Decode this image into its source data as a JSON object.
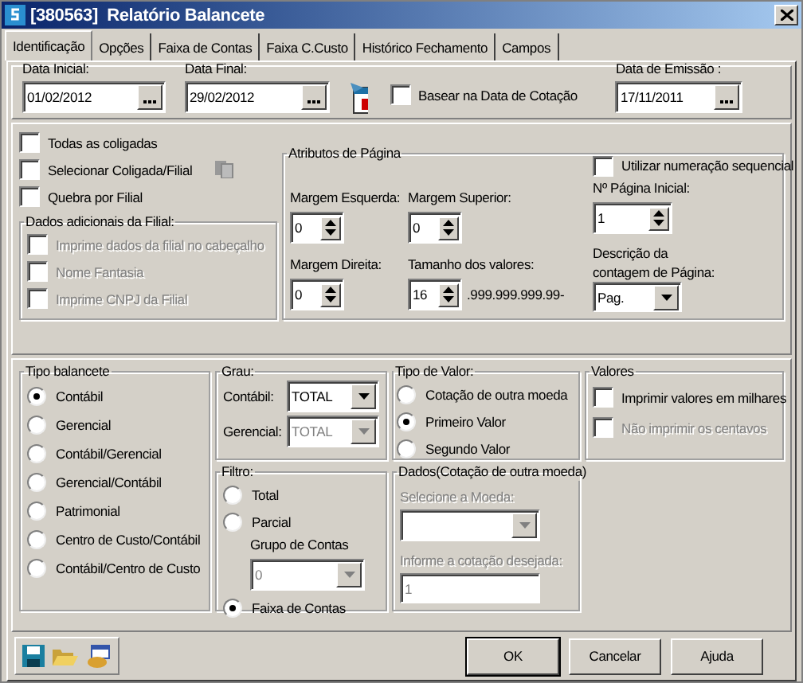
{
  "window": {
    "title": "[380563]  Relatório Balancete"
  },
  "tabs": [
    {
      "label": "Identificação",
      "selected": true
    },
    {
      "label": "Opções",
      "selected": false
    },
    {
      "label": "Faixa de Contas",
      "selected": false
    },
    {
      "label": "Faixa C.Custo",
      "selected": false
    },
    {
      "label": "Histórico Fechamento",
      "selected": false
    },
    {
      "label": "Campos",
      "selected": false
    }
  ],
  "dates": {
    "data_inicial": {
      "label": "Data Inicial:",
      "value": "01/02/2012"
    },
    "data_final": {
      "label": "Data Final:",
      "value": "29/02/2012"
    },
    "basear": {
      "label": "Basear na Data de Cotação",
      "checked": false
    },
    "data_emissao": {
      "label": "Data de Emissão :",
      "value": "17/11/2011"
    }
  },
  "left_options": [
    {
      "label": "Todas as coligadas",
      "checked": false
    },
    {
      "label": "Selecionar Coligada/Filial",
      "checked": false
    },
    {
      "label": "Quebra por Filial",
      "checked": false
    }
  ],
  "dados_filial": {
    "title": "Dados adicionais da Filial:",
    "options": [
      {
        "label": "Imprime dados da filial no cabeçalho",
        "checked": false,
        "disabled": true
      },
      {
        "label": "Nome Fantasia",
        "checked": false,
        "disabled": true
      },
      {
        "label": "Imprime CNPJ da Filial",
        "checked": false,
        "disabled": true
      }
    ]
  },
  "atributos": {
    "title": "Atributos de Página",
    "margem_esquerda": {
      "label": "Margem Esquerda:",
      "value": "0"
    },
    "margem_superior": {
      "label": "Margem Superior:",
      "value": "0"
    },
    "margem_direita": {
      "label": "Margem Direita:",
      "value": "0"
    },
    "tamanho": {
      "label": "Tamanho dos valores:",
      "value": "16",
      "mask": ".999.999.999.99-"
    },
    "sequencial": {
      "label": "Utilizar numeração sequencial",
      "checked": false
    },
    "pagina_inicial": {
      "label": "Nº Página Inicial:",
      "value": "1"
    },
    "descricao": {
      "label": "Descrição da contagem de Página:",
      "value": "Pag."
    }
  },
  "tipo_balancete": {
    "title": "Tipo balancete",
    "options": [
      {
        "label": "Contábil",
        "selected": true
      },
      {
        "label": "Gerencial",
        "selected": false
      },
      {
        "label": "Contábil/Gerencial",
        "selected": false
      },
      {
        "label": "Gerencial/Contábil",
        "selected": false
      },
      {
        "label": "Patrimonial",
        "selected": false
      },
      {
        "label": "Centro de Custo/Contábil",
        "selected": false
      },
      {
        "label": "Contábil/Centro de Custo",
        "selected": false
      }
    ]
  },
  "grau": {
    "title": "Grau:",
    "fields": [
      {
        "label": "Contábil:",
        "value": "TOTAL",
        "disabled": false
      },
      {
        "label": "Gerencial:",
        "value": "TOTAL",
        "disabled": true
      }
    ]
  },
  "filtro": {
    "title": "Filtro:",
    "options": [
      {
        "label": "Total",
        "selected": false
      },
      {
        "label": "Parcial",
        "selected": false
      },
      {
        "label": "Faixa de Contas",
        "selected": true
      }
    ],
    "grupo": {
      "label": "Grupo de Contas",
      "value": "0",
      "disabled": true
    }
  },
  "tipo_valor": {
    "title": "Tipo de Valor:",
    "options": [
      {
        "label": "Cotação de outra moeda",
        "selected": false
      },
      {
        "label": "Primeiro Valor",
        "selected": true
      },
      {
        "label": "Segundo Valor",
        "selected": false
      }
    ]
  },
  "dados_cotacao": {
    "title": "Dados(Cotação de outra moeda)",
    "moeda": {
      "label": "Selecione a Moeda:",
      "disabled": true
    },
    "cotacao": {
      "label": "Informe a cotação desejada:",
      "value": "1",
      "disabled": true
    }
  },
  "valores": {
    "title": "Valores",
    "options": [
      {
        "label": "Imprimir valores em milhares",
        "checked": false,
        "disabled": false
      },
      {
        "label": "Não imprimir os centavos",
        "checked": false,
        "disabled": true
      }
    ]
  },
  "buttons": [
    {
      "label": "OK",
      "kind": "default"
    },
    {
      "label": "Cancelar",
      "kind": "normal"
    },
    {
      "label": "Ajuda",
      "kind": "normal"
    }
  ]
}
